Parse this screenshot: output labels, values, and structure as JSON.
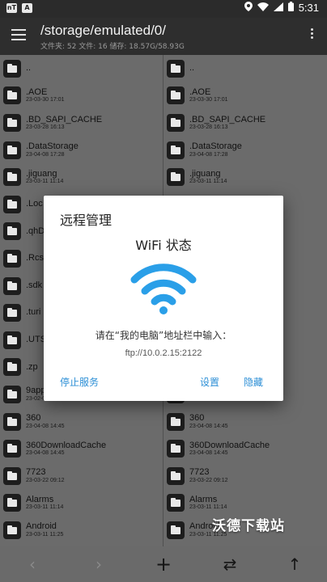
{
  "status_bar": {
    "badge_1": "nT",
    "badge_2": "A",
    "time": "5:31"
  },
  "toolbar": {
    "path": "/storage/emulated/0/",
    "summary": "文件夹: 52  文件: 16  储存: 18.57G/58.93G"
  },
  "left_pane": [
    {
      "name": "..",
      "date": ""
    },
    {
      "name": ".AOE",
      "date": "23-03-30 17:01"
    },
    {
      "name": ".BD_SAPI_CACHE",
      "date": "23-03-28 16:13"
    },
    {
      "name": ".DataStorage",
      "date": "23-04-08 17:28"
    },
    {
      "name": ".jiguang",
      "date": "23-03-11 11:14"
    },
    {
      "name": ".Loc",
      "date": ""
    },
    {
      "name": ".qhD",
      "date": ""
    },
    {
      "name": ".Rcs",
      "date": ""
    },
    {
      "name": ".sdk",
      "date": ""
    },
    {
      "name": ".turi",
      "date": ""
    },
    {
      "name": ".UTS",
      "date": ""
    },
    {
      "name": ".zp",
      "date": ""
    },
    {
      "name": "9app",
      "date": "23-02-07 10:52"
    },
    {
      "name": "360",
      "date": "23-04-08 14:45"
    },
    {
      "name": "360DownloadCache",
      "date": "23-04-08 14:45"
    },
    {
      "name": "7723",
      "date": "23-03-22 09:12"
    },
    {
      "name": "Alarms",
      "date": "23-03-11 11:14"
    },
    {
      "name": "Android",
      "date": "23-03-11 11:25"
    }
  ],
  "right_pane": [
    {
      "name": "..",
      "date": ""
    },
    {
      "name": ".AOE",
      "date": "23-03-30 17:01"
    },
    {
      "name": ".BD_SAPI_CACHE",
      "date": "23-03-28 16:13"
    },
    {
      "name": ".DataStorage",
      "date": "23-04-08 17:28"
    },
    {
      "name": ".jiguang",
      "date": "23-03-11 11:14"
    },
    {
      "name": "",
      "date": ""
    },
    {
      "name": "",
      "date": ""
    },
    {
      "name": "",
      "date": ""
    },
    {
      "name": "",
      "date": ""
    },
    {
      "name": "",
      "date": ""
    },
    {
      "name": "",
      "date": ""
    },
    {
      "name": "",
      "date": ""
    },
    {
      "name": "",
      "date": ""
    },
    {
      "name": "360",
      "date": "23-04-08 14:45"
    },
    {
      "name": "360DownloadCache",
      "date": "23-04-08 14:45"
    },
    {
      "name": "7723",
      "date": "23-03-22 09:12"
    },
    {
      "name": "Alarms",
      "date": "23-03-11 11:14"
    },
    {
      "name": "Android",
      "date": "23-03-11 11:25"
    }
  ],
  "dialog": {
    "title": "远程管理",
    "status": "WiFi 状态",
    "instruction": "请在“我的电脑”地址栏中输入：",
    "address": "ftp://10.0.2.15:2122",
    "stop_label": "停止服务",
    "settings_label": "设置",
    "hide_label": "隐藏",
    "accent_color": "#2d8fd6",
    "wifi_color": "#2a9fe8"
  },
  "bottom_bar": {
    "back": "‹",
    "forward": "›",
    "add": "+",
    "swap": "⇄",
    "up": "↑"
  },
  "watermark": "沃德下载站"
}
